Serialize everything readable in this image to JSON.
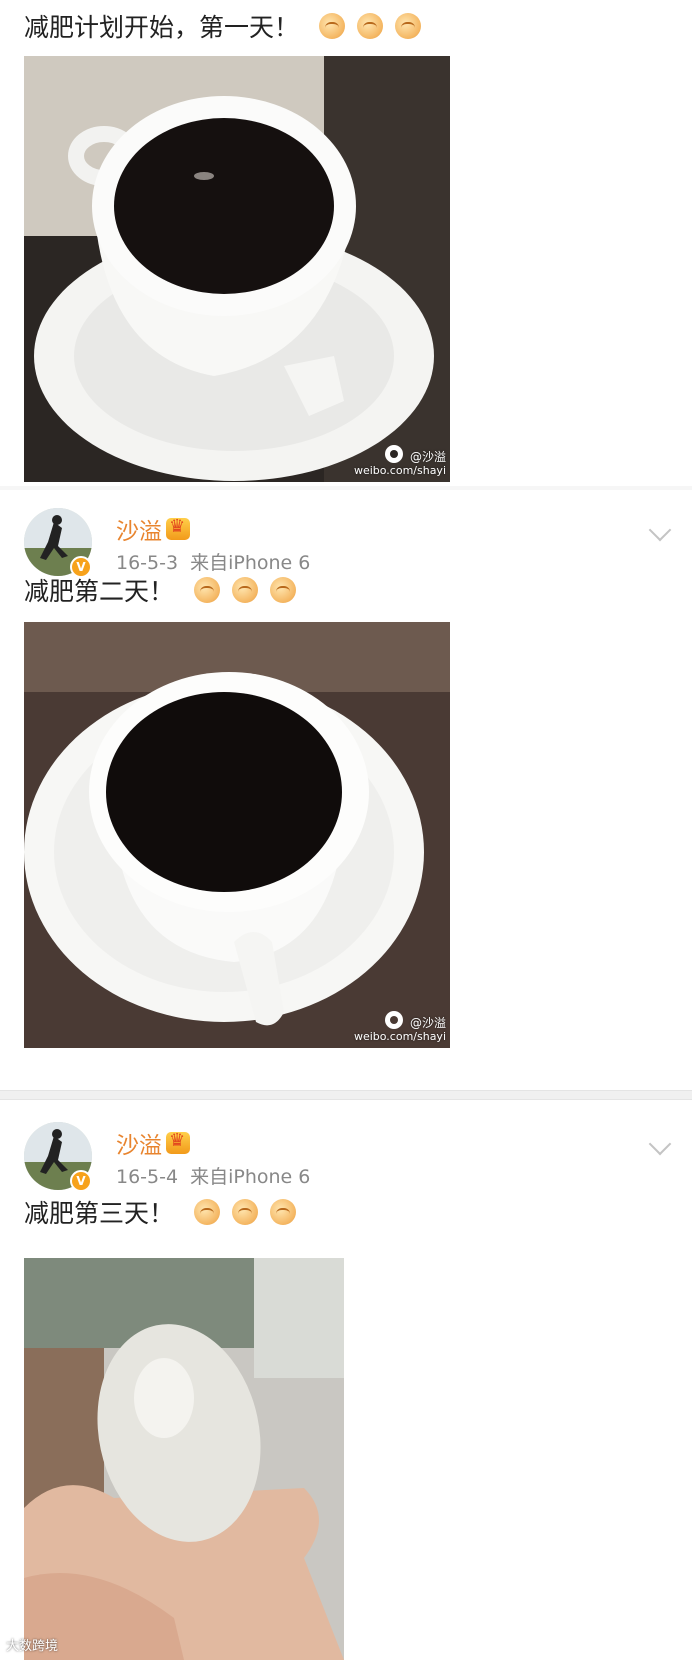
{
  "posts": [
    {
      "text": "减肥计划开始，第一天！",
      "watermark_handle": "@沙溢",
      "watermark_url": "weibo.com/shayi"
    },
    {
      "user": "沙溢",
      "date": "16-5-3",
      "source": "来自iPhone 6",
      "text": "减肥第二天！",
      "watermark_handle": "@沙溢",
      "watermark_url": "weibo.com/shayi"
    },
    {
      "user": "沙溢",
      "date": "16-5-4",
      "source": "来自iPhone 6",
      "text": "减肥第三天！"
    }
  ],
  "verified_badge": "V",
  "footer_watermark": "大数跨境",
  "icons": [
    "fist-emoji-icon",
    "crown-icon",
    "chevron-down-icon",
    "weibo-logo-icon"
  ]
}
